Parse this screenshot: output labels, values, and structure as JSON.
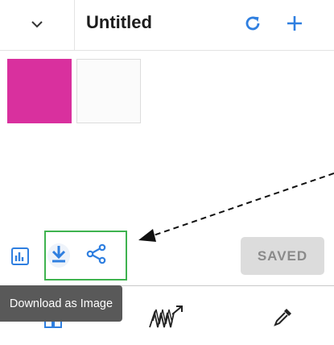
{
  "header": {
    "title": "Untitled",
    "icons": {
      "collapse": "chevron-down-icon",
      "refresh": "refresh-icon",
      "add": "plus-icon"
    }
  },
  "palette": {
    "swatches": [
      {
        "color": "#d9309e"
      },
      {
        "color": "#fbfbfb"
      }
    ]
  },
  "toolbar": {
    "icons": {
      "chart": "bar-chart-icon",
      "download": "download-icon",
      "share": "share-icon"
    },
    "saved_label": "SAVED"
  },
  "tooltip": {
    "text": "Download as Image"
  },
  "bottom_nav": {
    "icons": [
      "grid-icon",
      "wave-chart-icon",
      "eyedropper-icon"
    ]
  },
  "colors": {
    "accent": "#2f7fe0",
    "highlight_box": "#3fb34f",
    "tooltip_bg": "#595959",
    "swatch_selected": "#d9309e"
  }
}
